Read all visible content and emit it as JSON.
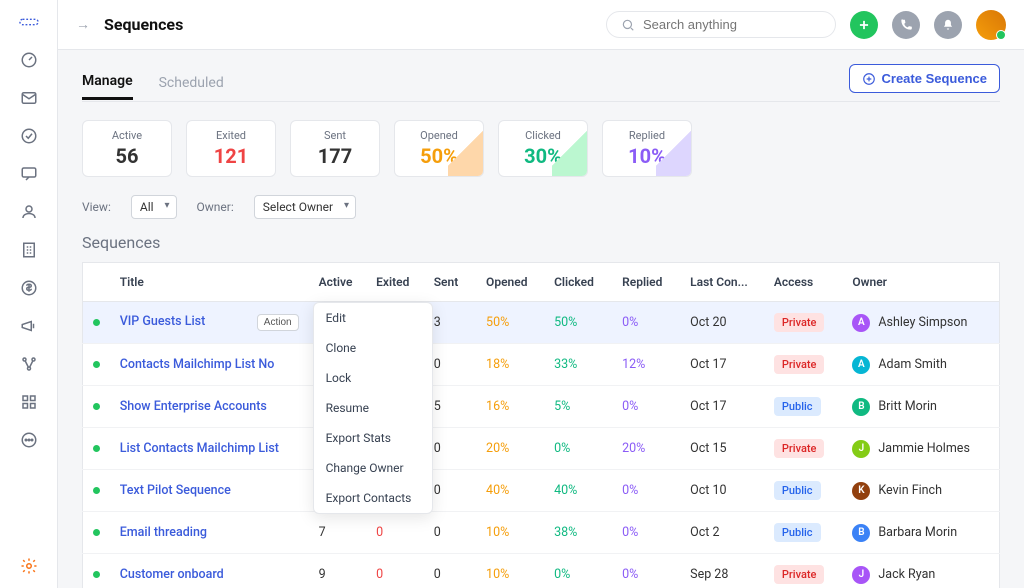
{
  "header": {
    "title": "Sequences",
    "search_placeholder": "Search anything"
  },
  "tabs": {
    "manage": "Manage",
    "scheduled": "Scheduled"
  },
  "create_btn": "Create Sequence",
  "stats": {
    "active": {
      "label": "Active",
      "value": "56",
      "color": "#111"
    },
    "exited": {
      "label": "Exited",
      "value": "121",
      "color": "#ef4444"
    },
    "sent": {
      "label": "Sent",
      "value": "177",
      "color": "#111"
    },
    "opened": {
      "label": "Opened",
      "value": "50%",
      "color": "#f59e0b"
    },
    "clicked": {
      "label": "Clicked",
      "value": "30%",
      "color": "#10b981"
    },
    "replied": {
      "label": "Replied",
      "value": "10%",
      "color": "#8b5cf6"
    }
  },
  "filters": {
    "view_label": "View:",
    "view_value": "All",
    "owner_label": "Owner:",
    "owner_value": "Select Owner"
  },
  "section_title": "Sequences",
  "cols": {
    "title": "Title",
    "active": "Active",
    "exited": "Exited",
    "sent": "Sent",
    "opened": "Opened",
    "clicked": "Clicked",
    "replied": "Replied",
    "last": "Last Con...",
    "access": "Access",
    "owner": "Owner"
  },
  "action_label": "Action",
  "menu": [
    "Edit",
    "Clone",
    "Lock",
    "Resume",
    "Export Stats",
    "Change Owner",
    "Export Contacts"
  ],
  "rows": [
    {
      "title": "VIP Guests List",
      "active": "",
      "exited": "",
      "sent": "3",
      "opened": "50%",
      "clicked": "50%",
      "replied": "0%",
      "last": "Oct 20",
      "access": "Private",
      "owner": {
        "initial": "A",
        "name": "Ashley Simpson",
        "bg": "#a855f7"
      }
    },
    {
      "title": "Contacts Mailchimp List No",
      "active": "",
      "exited": "",
      "sent": "0",
      "opened": "18%",
      "clicked": "33%",
      "replied": "12%",
      "last": "Oct 17",
      "access": "Private",
      "owner": {
        "initial": "A",
        "name": "Adam Smith",
        "bg": "#06b6d4"
      }
    },
    {
      "title": "Show Enterprise Accounts",
      "active": "",
      "exited": "",
      "sent": "5",
      "opened": "16%",
      "clicked": "5%",
      "replied": "0%",
      "last": "Oct 17",
      "access": "Public",
      "owner": {
        "initial": "B",
        "name": "Britt Morin",
        "bg": "#10b981"
      }
    },
    {
      "title": "List Contacts Mailchimp List",
      "active": "",
      "exited": "",
      "sent": "0",
      "opened": "20%",
      "clicked": "0%",
      "replied": "20%",
      "last": "Oct 15",
      "access": "Private",
      "owner": {
        "initial": "J",
        "name": "Jammie Holmes",
        "bg": "#84cc16"
      }
    },
    {
      "title": "Text Pilot Sequence",
      "active": "",
      "exited": "",
      "sent": "0",
      "opened": "40%",
      "clicked": "40%",
      "replied": "0%",
      "last": "Oct 10",
      "access": "Public",
      "owner": {
        "initial": "K",
        "name": "Kevin Finch",
        "bg": "#92400e"
      }
    },
    {
      "title": "Email threading",
      "active": "7",
      "exited": "0",
      "sent": "0",
      "opened": "10%",
      "clicked": "38%",
      "replied": "0%",
      "last": "Oct 2",
      "access": "Public",
      "owner": {
        "initial": "B",
        "name": "Barbara Morin",
        "bg": "#3b82f6"
      }
    },
    {
      "title": "Customer onboard",
      "active": "9",
      "exited": "0",
      "sent": "0",
      "opened": "10%",
      "clicked": "0%",
      "replied": "0%",
      "last": "Sep 28",
      "access": "Private",
      "owner": {
        "initial": "J",
        "name": "Jack Ryan",
        "bg": "#a855f7"
      }
    }
  ]
}
